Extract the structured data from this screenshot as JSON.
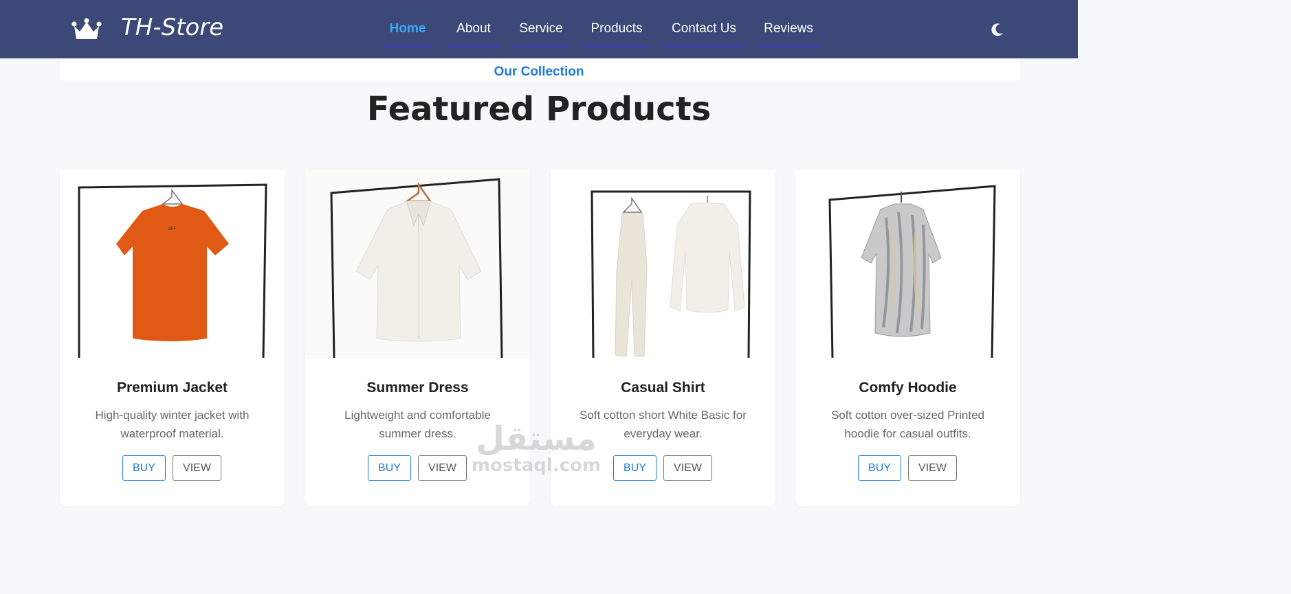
{
  "navbar": {
    "brand": "TH-Store",
    "logo_icon": "crown-icon",
    "items": [
      {
        "label": "Home",
        "active": true
      },
      {
        "label": "About",
        "active": false
      },
      {
        "label": "Service",
        "active": false
      },
      {
        "label": "Products",
        "active": false
      },
      {
        "label": "Contact Us",
        "active": false
      },
      {
        "label": "Reviews",
        "active": false
      }
    ],
    "theme_toggle_icon": "moon-icon",
    "colors": {
      "background": "#3b4878",
      "active": "#3aaaf6",
      "underline": "#3d39c6"
    }
  },
  "section": {
    "eyebrow": "Our Collection",
    "title": "Featured Products"
  },
  "products": [
    {
      "name": "Premium Jacket",
      "description": "High-quality winter jacket with waterproof material.",
      "buy_label": "BUY",
      "view_label": "VIEW",
      "image": "orange-tshirt-on-rack"
    },
    {
      "name": "Summer Dress",
      "description": "Lightweight and comfortable summer dress.",
      "buy_label": "BUY",
      "view_label": "VIEW",
      "image": "white-knit-shirt-on-rack"
    },
    {
      "name": "Casual Shirt",
      "description": "Soft cotton short White Basic for everyday wear.",
      "buy_label": "BUY",
      "view_label": "VIEW",
      "image": "linen-pants-and-shirt-on-rack"
    },
    {
      "name": "Comfy Hoodie",
      "description": "Soft cotton over-sized Printed hoodie for casual outfits.",
      "buy_label": "BUY",
      "view_label": "VIEW",
      "image": "printed-shirt-on-rack"
    }
  ],
  "watermark": {
    "arabic": "مستقل",
    "latin": "mostaql.com"
  }
}
